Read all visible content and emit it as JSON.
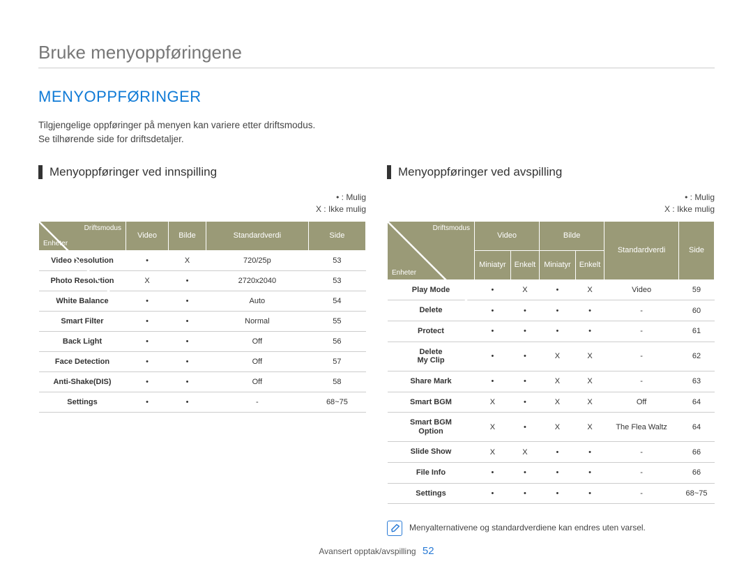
{
  "page_title": "Bruke menyoppføringene",
  "section_title": "MENYOPPFØRINGER",
  "intro_line1": "Tilgjengelige oppføringer på menyen kan variere etter driftsmodus.",
  "intro_line2": "Se tilhørende side for driftsdetaljer.",
  "legend": {
    "possible": "• : Mulig",
    "not_possible": "X : Ikke mulig"
  },
  "diag": {
    "top": "Driftsmodus",
    "bottom": "Enheter"
  },
  "left": {
    "title": "Menyoppføringer ved innspilling",
    "headers": [
      "Video",
      "Bilde",
      "Standardverdi",
      "Side"
    ],
    "rows": [
      {
        "name": "Video Resolution",
        "cells": [
          "•",
          "X",
          "720/25p",
          "53"
        ]
      },
      {
        "name": "Photo Resolution",
        "cells": [
          "X",
          "•",
          "2720x2040",
          "53"
        ]
      },
      {
        "name": "White Balance",
        "cells": [
          "•",
          "•",
          "Auto",
          "54"
        ]
      },
      {
        "name": "Smart Filter",
        "cells": [
          "•",
          "•",
          "Normal",
          "55"
        ]
      },
      {
        "name": "Back Light",
        "cells": [
          "•",
          "•",
          "Off",
          "56"
        ]
      },
      {
        "name": "Face Detection",
        "cells": [
          "•",
          "•",
          "Off",
          "57"
        ]
      },
      {
        "name": "Anti-Shake(DIS)",
        "cells": [
          "•",
          "•",
          "Off",
          "58"
        ]
      },
      {
        "name": "Settings",
        "cells": [
          "•",
          "•",
          "-",
          "68~75"
        ]
      }
    ]
  },
  "right": {
    "title": "Menyoppføringer ved avspilling",
    "group_headers": [
      "Video",
      "Bilde",
      "Standardverdi",
      "Side"
    ],
    "sub_headers": [
      "Miniatyr",
      "Enkelt",
      "Miniatyr",
      "Enkelt"
    ],
    "rows": [
      {
        "name": "Play Mode",
        "cells": [
          "•",
          "X",
          "•",
          "X",
          "Video",
          "59"
        ]
      },
      {
        "name": "Delete",
        "cells": [
          "•",
          "•",
          "•",
          "•",
          "-",
          "60"
        ]
      },
      {
        "name": "Protect",
        "cells": [
          "•",
          "•",
          "•",
          "•",
          "-",
          "61"
        ]
      },
      {
        "name": "Delete\nMy Clip",
        "cells": [
          "•",
          "•",
          "X",
          "X",
          "-",
          "62"
        ]
      },
      {
        "name": "Share Mark",
        "cells": [
          "•",
          "•",
          "X",
          "X",
          "-",
          "63"
        ]
      },
      {
        "name": "Smart BGM",
        "cells": [
          "X",
          "•",
          "X",
          "X",
          "Off",
          "64"
        ]
      },
      {
        "name": "Smart BGM\nOption",
        "cells": [
          "X",
          "•",
          "X",
          "X",
          "The Flea Waltz",
          "64"
        ]
      },
      {
        "name": "Slide Show",
        "cells": [
          "X",
          "X",
          "•",
          "•",
          "-",
          "66"
        ]
      },
      {
        "name": "File Info",
        "cells": [
          "•",
          "•",
          "•",
          "•",
          "-",
          "66"
        ]
      },
      {
        "name": "Settings",
        "cells": [
          "•",
          "•",
          "•",
          "•",
          "-",
          "68~75"
        ]
      }
    ]
  },
  "note": "Menyalternativene og standardverdiene kan endres uten varsel.",
  "footer_text": "Avansert opptak/avspilling",
  "page_number": "52"
}
